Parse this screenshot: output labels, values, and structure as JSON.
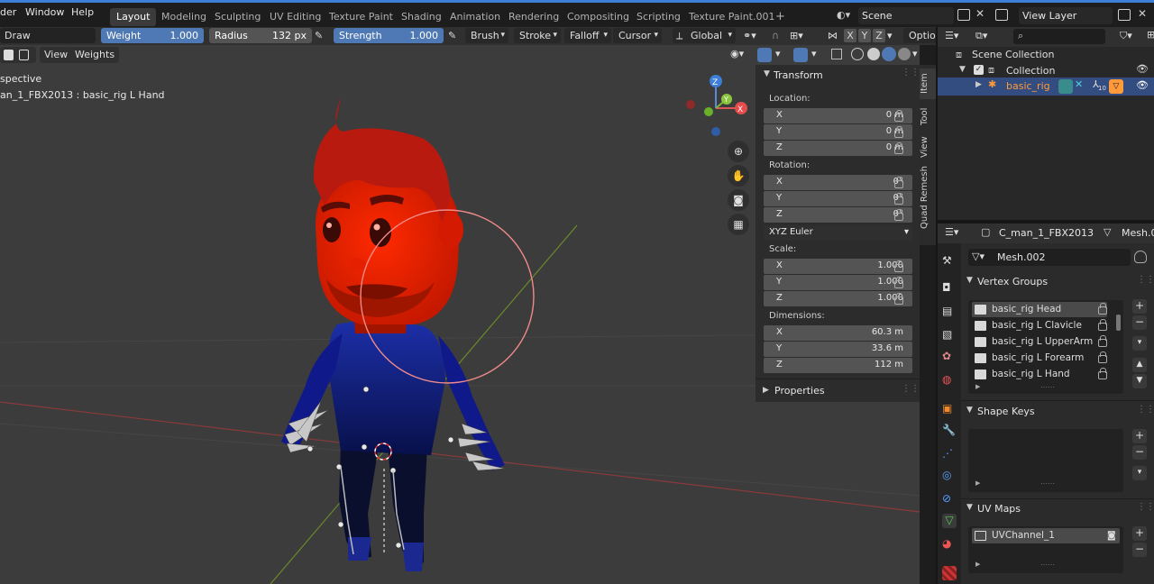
{
  "topbar": {
    "menus": [
      "der",
      "Window",
      "Help"
    ],
    "workspaces": [
      "Layout",
      "Modeling",
      "Sculpting",
      "UV Editing",
      "Texture Paint",
      "Shading",
      "Animation",
      "Rendering",
      "Compositing",
      "Scripting",
      "Texture Paint.001"
    ],
    "active_workspace": "Layout",
    "add_workspace": "+",
    "scene": "Scene",
    "view_layer": "View Layer"
  },
  "tool_header": {
    "brush_name": "Draw",
    "weight_label": "Weight",
    "weight_value": "1.000",
    "radius_label": "Radius",
    "radius_value": "132 px",
    "strength_label": "Strength",
    "strength_value": "1.000",
    "brush": "Brush",
    "stroke": "Stroke",
    "falloff": "Falloff",
    "cursor": "Cursor",
    "orientation": "Global",
    "axes": [
      "X",
      "Y",
      "Z"
    ],
    "options": "Option"
  },
  "viewport": {
    "view_menu": "View",
    "weights_menu": "Weights",
    "overlay_line1": "spective",
    "overlay_line2": "an_1_FBX2013 : basic_rig L Hand",
    "gizmo": {
      "x": "X",
      "y": "Y",
      "z": "Z"
    }
  },
  "npanel": {
    "tabs": [
      "Item",
      "Tool",
      "View",
      "Quad Remesh"
    ],
    "transform_title": "Transform",
    "location_label": "Location:",
    "location": [
      {
        "axis": "X",
        "value": "0 m"
      },
      {
        "axis": "Y",
        "value": "0 m"
      },
      {
        "axis": "Z",
        "value": "0 m"
      }
    ],
    "rotation_label": "Rotation:",
    "rotation": [
      {
        "axis": "X",
        "value": "0°"
      },
      {
        "axis": "Y",
        "value": "0°"
      },
      {
        "axis": "Z",
        "value": "0°"
      }
    ],
    "rotation_mode": "XYZ Euler",
    "scale_label": "Scale:",
    "scale": [
      {
        "axis": "X",
        "value": "1.000"
      },
      {
        "axis": "Y",
        "value": "1.000"
      },
      {
        "axis": "Z",
        "value": "1.000"
      }
    ],
    "dimensions_label": "Dimensions:",
    "dimensions": [
      {
        "axis": "X",
        "value": "60.3 m"
      },
      {
        "axis": "Y",
        "value": "33.6 m"
      },
      {
        "axis": "Z",
        "value": "112 m"
      }
    ],
    "properties_title": "Properties"
  },
  "outliner": {
    "scene_collection": "Scene Collection",
    "collection": "Collection",
    "object": "basic_rig",
    "badge": "10"
  },
  "properties": {
    "object_name": "C_man_1_FBX2013",
    "data_crumb": "Mesh.0",
    "mesh_name": "Mesh.002",
    "vertex_groups_title": "Vertex Groups",
    "vertex_groups": [
      "basic_rig Head",
      "basic_rig L Clavicle",
      "basic_rig L UpperArm",
      "basic_rig L Forearm",
      "basic_rig L Hand"
    ],
    "shape_keys_title": "Shape Keys",
    "uv_maps_title": "UV Maps",
    "uv_map": "UVChannel_1"
  }
}
